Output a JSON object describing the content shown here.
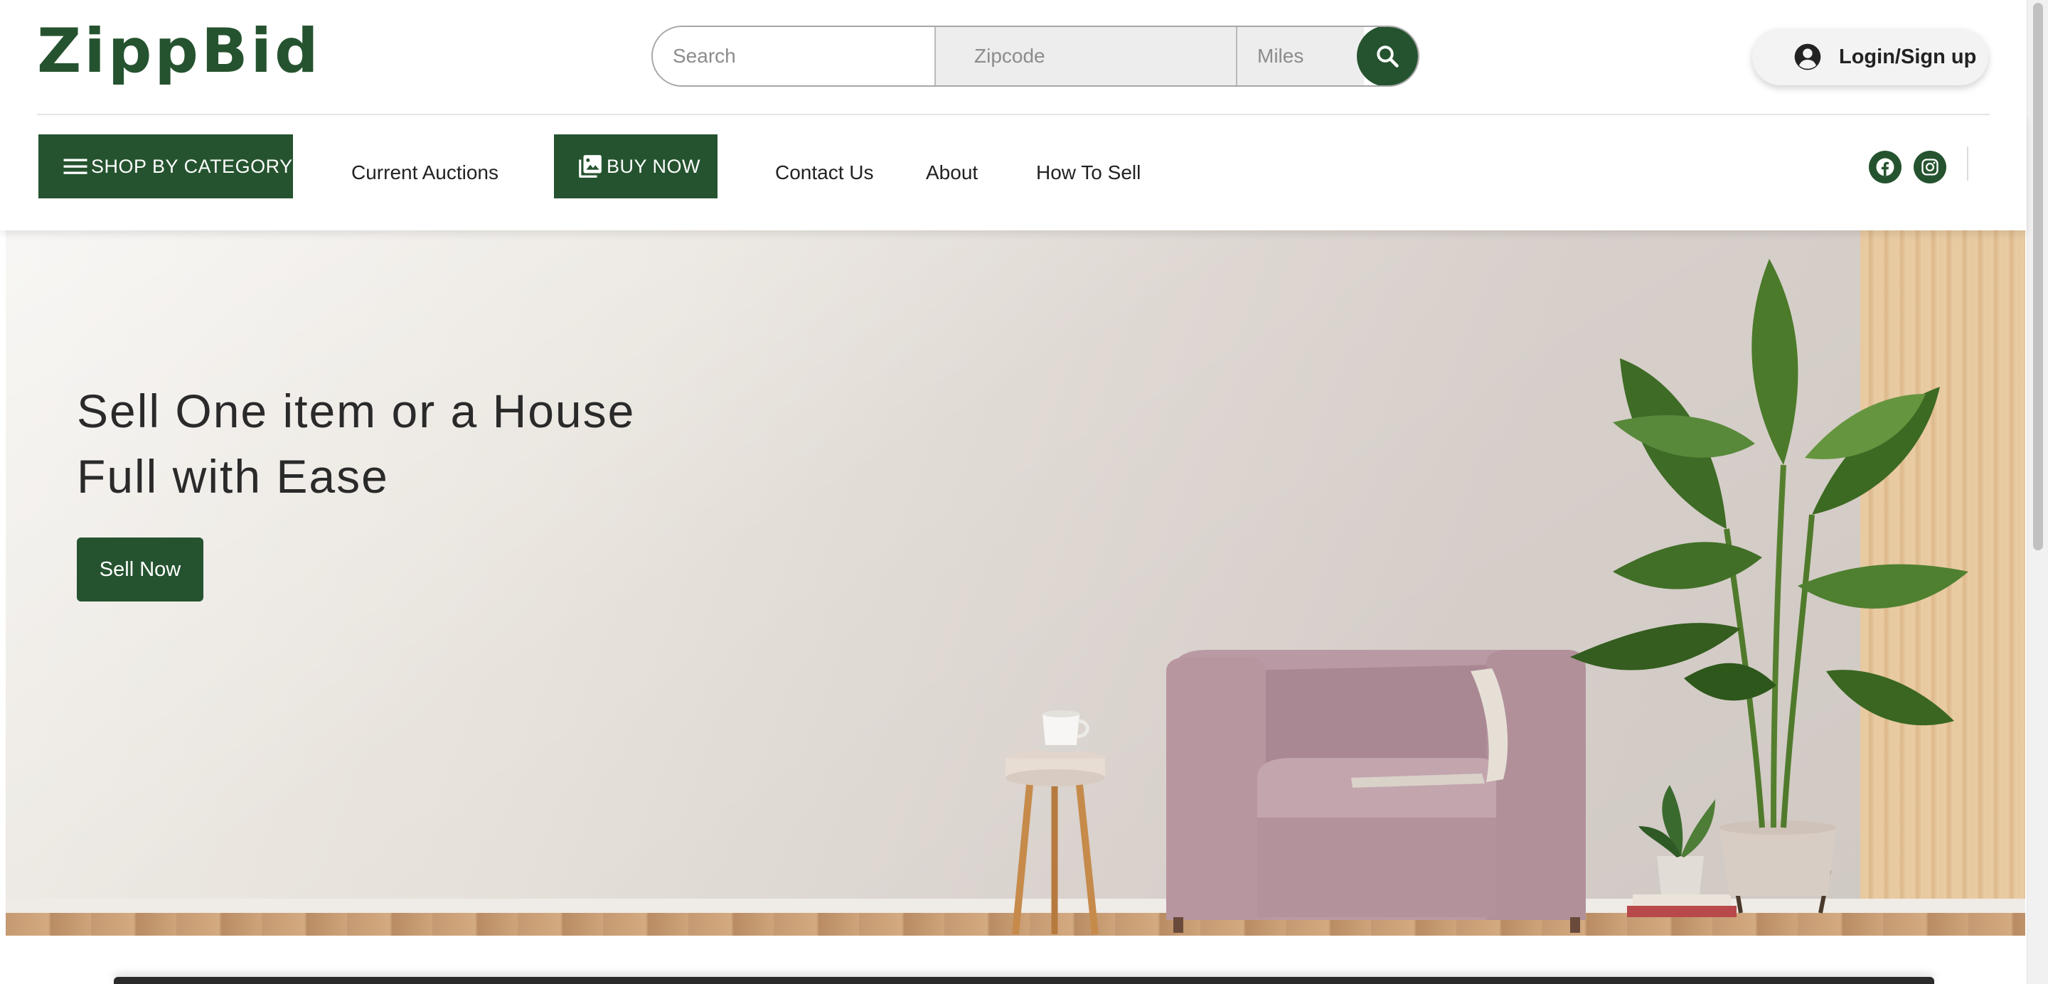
{
  "brand": {
    "logo_text": "ZippBid",
    "color": "#25532f"
  },
  "search": {
    "search_placeholder": "Search",
    "zip_placeholder": "Zipcode",
    "miles_placeholder": "Miles",
    "button_icon": "search-icon"
  },
  "account": {
    "login_label": "Login/Sign up",
    "icon": "user-circle-icon"
  },
  "nav": {
    "shop_by_category": "SHOP BY CATEGORY",
    "current_auctions": "Current Auctions",
    "buy_now": "BUY NOW",
    "contact_us": "Contact Us",
    "about": "About",
    "how_to_sell": "How To Sell"
  },
  "social": [
    {
      "icon": "facebook-icon"
    },
    {
      "icon": "instagram-icon"
    }
  ],
  "hero": {
    "title": "Sell One item or a House Full with Ease",
    "cta_label": "Sell Now",
    "image": "living-room-armchair-plant-image"
  }
}
